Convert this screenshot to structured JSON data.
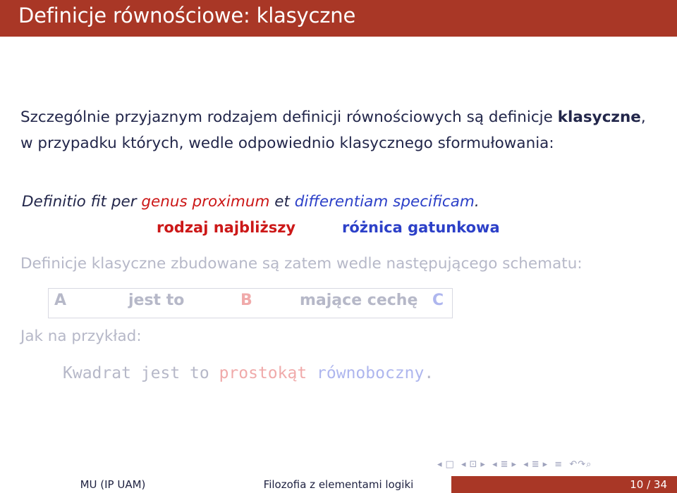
{
  "slide": {
    "title": "Definicje równościowe: klasyczne"
  },
  "paragraph": {
    "part1": "Szczególnie przyjaznym rodzajem definicji równościowych są definicje ",
    "bold": "klasyczne",
    "part2": ", w przypadku których, wedle odpowiednio klasycznego sformułowania:"
  },
  "latin": {
    "prefix": "Definitio fit per ",
    "genus": "genus proximum",
    "middle": " et ",
    "differentia": "differentiam specificam",
    "end": "."
  },
  "gloss": {
    "genus": "rodzaj najbliższy",
    "differentia": "różnica gatunkowa"
  },
  "schema": {
    "intro": "Definicje klasyczne zbudowane są zatem wedle następującego schematu:",
    "a": "A",
    "jest_to": "jest to",
    "b": "B",
    "majace": "mające cechę",
    "c": "C"
  },
  "example": {
    "intro": "Jak na przykład:",
    "part1": "Kwadrat jest to ",
    "b": "prostokąt",
    "space": " ",
    "c": "równoboczny",
    "end": "."
  },
  "navigation": {
    "first": "◂",
    "frame": "□",
    "prev_section": "◂",
    "section": "⊡",
    "next_section": "▸",
    "prev_sub": "◂",
    "sub": "≣",
    "next_sub": "▸",
    "prev_slide": "◂",
    "slide": "≣",
    "next_slide": "▸",
    "align": "≡",
    "search": "↶↷⌕"
  },
  "footer": {
    "author": "MU  (IP UAM)",
    "course": "Filozofia z elementami logiki",
    "page": "10 / 34"
  }
}
